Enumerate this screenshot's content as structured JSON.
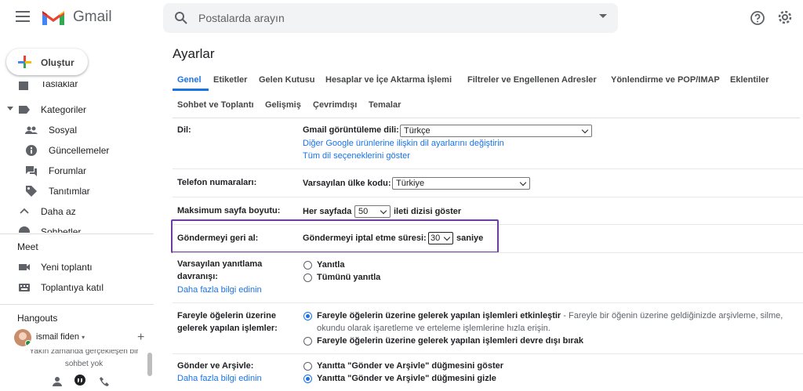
{
  "app": {
    "name": "Gmail"
  },
  "search": {
    "placeholder": "Postalarda arayın"
  },
  "sidebar": {
    "compose_label": "Oluştur",
    "items": [
      {
        "label": "Taslaklar"
      },
      {
        "label": "Kategoriler"
      },
      {
        "label": "Sosyal"
      },
      {
        "label": "Güncellemeler"
      },
      {
        "label": "Forumlar"
      },
      {
        "label": "Tanıtımlar"
      },
      {
        "label": "Daha az"
      },
      {
        "label": "Sohbetler"
      }
    ],
    "meet": {
      "title": "Meet",
      "new_meeting": "Yeni toplantı",
      "join": "Toplantıya katıl"
    },
    "hangouts": {
      "title": "Hangouts",
      "user": "ismail fiden",
      "note_line1": "Yakın zamanda gerçekleşen bir",
      "note_line2": "sohbet yok"
    }
  },
  "page": {
    "title": "Ayarlar"
  },
  "tabs": {
    "row1": [
      "Genel",
      "Etiketler",
      "Gelen Kutusu",
      "Hesaplar ve İçe Aktarma İşlemi",
      "Filtreler ve Engellenen Adresler",
      "Yönlendirme ve POP/IMAP",
      "Eklentiler"
    ],
    "row2": [
      "Sohbet ve Toplantı",
      "Gelişmiş",
      "Çevrimdışı",
      "Temalar"
    ]
  },
  "settings": {
    "language": {
      "label": "Dil:",
      "display_label": "Gmail görüntüleme dili:",
      "display_value": "Türkçe",
      "link1": "Diğer Google ürünlerine ilişkin dil ayarlarını değiştirin",
      "link2": "Tüm dil seçeneklerini göster"
    },
    "phone": {
      "label": "Telefon numaraları:",
      "country_label": "Varsayılan ülke kodu:",
      "country_value": "Türkiye"
    },
    "page_size": {
      "label": "Maksimum sayfa boyutu:",
      "prefix": "Her sayfada",
      "value": "50",
      "suffix": "ileti dizisi göster"
    },
    "undo_send": {
      "label": "Göndermeyi geri al:",
      "prefix": "Göndermeyi iptal etme süresi:",
      "value": "30",
      "suffix": "saniye"
    },
    "reply": {
      "label_line1": "Varsayılan yanıtlama",
      "label_line2": "davranışı:",
      "link": "Daha fazla bilgi edinin",
      "opt1": "Yanıtla",
      "opt2": "Tümünü yanıtla"
    },
    "hover": {
      "label_line1": "Fareyle öğelerin üzerine",
      "label_line2": "gelerek yapılan işlemler:",
      "opt1": "Fareyle öğelerin üzerine gelerek yapılan işlemleri etkinleştir",
      "opt1_desc_a": " - Fareyle bir öğenin üzerine geldiğinizde arşivleme, silme,",
      "opt1_desc_b": "okundu olarak işaretleme ve erteleme işlemlerine hızla erişin.",
      "opt2": "Fareyle öğelerin üzerine gelerek yapılan işlemleri devre dışı bırak"
    },
    "send_archive": {
      "label": "Gönder ve Arşivle:",
      "link": "Daha fazla bilgi edinin",
      "opt1": "Yanıtta \"Gönder ve Arşivle\" düğmesini göster",
      "opt2": "Yanıtta \"Gönder ve Arşivle\" düğmesini gizle"
    }
  },
  "colors": {
    "accent": "#1a73e8",
    "highlight_box": "#6b3fa0"
  }
}
